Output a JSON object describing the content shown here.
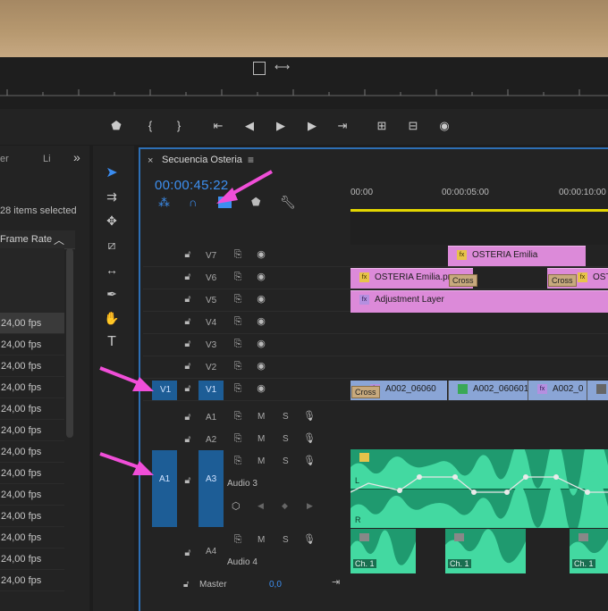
{
  "project": {
    "tab_er": "er",
    "tab_li": "Li",
    "more": "»",
    "selection_info": "28 items selected",
    "column_header": "Frame Rate",
    "rows": [
      "24,00 fps",
      "24,00 fps",
      "24,00 fps",
      "24,00 fps",
      "24,00 fps",
      "24,00 fps",
      "24,00 fps",
      "24,00 fps",
      "24,00 fps",
      "24,00 fps",
      "24,00 fps",
      "24,00 fps",
      "24,00 fps"
    ]
  },
  "timeline": {
    "close": "×",
    "title": "Secuencia Osteria",
    "menu": "≡",
    "timecode": "00:00:45:22",
    "ruler": [
      "00:00",
      "00:00:05:00",
      "00:00:10:00"
    ],
    "video_tracks": [
      "V7",
      "V6",
      "V5",
      "V4",
      "V3",
      "V2",
      "V1"
    ],
    "source_v1": "V1",
    "audio_tracks": [
      "A1",
      "A2",
      "A3",
      "A4"
    ],
    "source_a1": "A1",
    "audio3_name": "Audio 3",
    "audio4_name": "Audio 4",
    "m": "M",
    "s": "S",
    "master": "Master",
    "master_value": "0,0",
    "clips": {
      "v7": "OSTERIA Emilia",
      "v6a": "OSTERIA Emilia.png",
      "v6b": "OST",
      "v5": "Adjustment Layer",
      "v1a": "A002_06060",
      "v1b": "A002_060601",
      "v1c": "A002_0",
      "cross": "Cross",
      "ch1": "Ch. 1",
      "audio_l": "L",
      "audio_r": "R"
    }
  },
  "colors": {
    "accent_blue": "#2d6fb5",
    "pink_clip": "#dc8ad9",
    "audio_green": "#2fbf8c",
    "arrow": "#f04ed8"
  }
}
